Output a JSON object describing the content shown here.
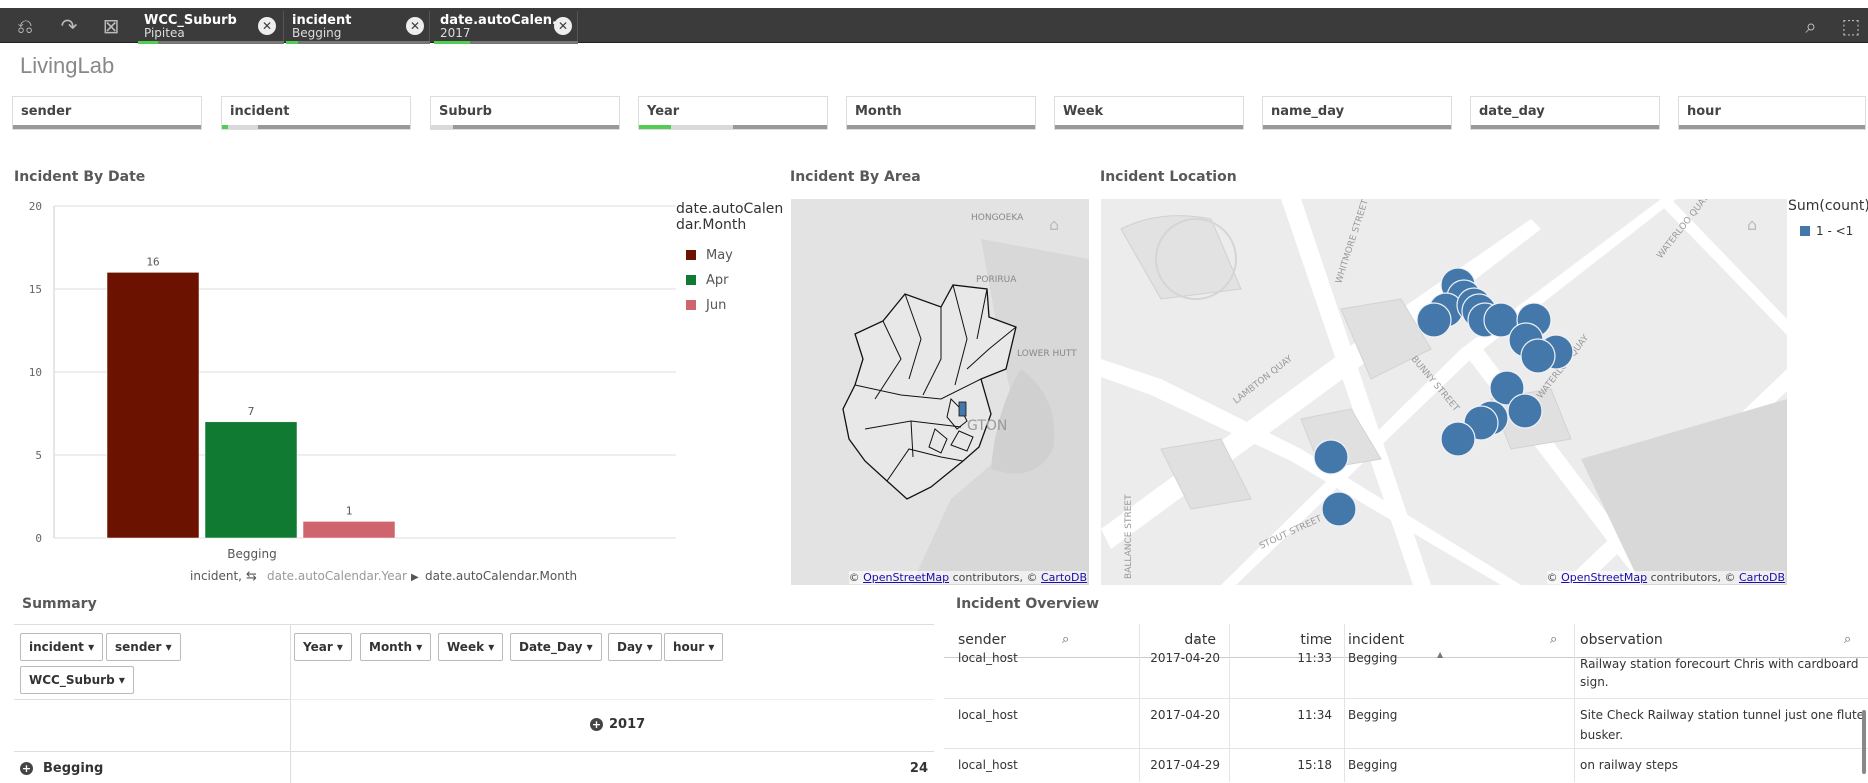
{
  "toolbar": {
    "icons": [
      "undo-icon",
      "redo-icon",
      "clear-selections-icon",
      "search-icon",
      "selection-tool-icon"
    ],
    "chips": [
      {
        "field": "WCC_Suburb",
        "value": "Pipitea"
      },
      {
        "field": "incident",
        "value": "Begging"
      },
      {
        "field": "date.autoCalen...",
        "value": "2017"
      }
    ]
  },
  "app": {
    "title": "LivingLab"
  },
  "filters": [
    {
      "label": "sender"
    },
    {
      "label": "incident"
    },
    {
      "label": "Suburb"
    },
    {
      "label": "Year"
    },
    {
      "label": "Month"
    },
    {
      "label": "Week"
    },
    {
      "label": "name_day"
    },
    {
      "label": "date_day"
    },
    {
      "label": "hour"
    }
  ],
  "sections": {
    "incident_by_date": "Incident By Date",
    "incident_by_area": "Incident By Area",
    "incident_location": "Incident Location",
    "summary": "Summary",
    "incident_overview": "Incident Overview"
  },
  "chart_data": {
    "type": "bar",
    "categories": [
      "Begging"
    ],
    "series": [
      {
        "name": "May",
        "values": [
          16
        ],
        "color": "#6b1200"
      },
      {
        "name": "Apr",
        "values": [
          7
        ],
        "color": "#107a32"
      },
      {
        "name": "Jun",
        "values": [
          1
        ],
        "color": "#d0646e"
      }
    ],
    "yticks": [
      0,
      5,
      10,
      15,
      20
    ],
    "ylim": [
      0,
      20
    ],
    "legend_title": "date.autoCalen-dar.Month",
    "legend_position": "right",
    "grid": true,
    "xlabel_prefix": "incident,",
    "xlabel_dim1": "date.autoCalendar.Year",
    "xlabel_dim2": "date.autoCalendar.Month"
  },
  "area_map": {
    "labels": [
      "HONGOEKA",
      "PORIRUA",
      "LOWER HUTT",
      "GTON"
    ],
    "attribution_prefix": "©",
    "attribution_link1": "OpenStreetMap",
    "attribution_middle": "contributors, ©",
    "attribution_link2": "CartoDB"
  },
  "location_map": {
    "street_labels": [
      "LAMBTON QUAY",
      "BUNNY STREET",
      "WATERLOO QUAY",
      "STOUT STREET",
      "WHITMORE STREET",
      "BALLANCE STREET",
      "WATERLOO QUAY"
    ],
    "legend_title": "Sum(count)",
    "legend_item": "1 - <1",
    "point_color": "#4477aa"
  },
  "summary": {
    "row_dims": [
      "incident",
      "sender",
      "WCC_Suburb"
    ],
    "col_dims": [
      "Year",
      "Month",
      "Week",
      "Date_Day",
      "Day",
      "hour"
    ],
    "year": "2017",
    "row_label": "Begging",
    "row_value": "24"
  },
  "overview": {
    "columns": [
      "sender",
      "date",
      "time",
      "incident",
      "observation"
    ],
    "rows": [
      {
        "sender": "local_host",
        "date": "2017-04-20",
        "time": "11:33",
        "incident": "Begging",
        "obs1": "Railway station forecourt Chris with cardboard",
        "obs2": "sign."
      },
      {
        "sender": "local_host",
        "date": "2017-04-20",
        "time": "11:34",
        "incident": "Begging",
        "obs1": "Site Check Railway station tunnel just one flute",
        "obs2": "busker."
      },
      {
        "sender": "local_host",
        "date": "2017-04-29",
        "time": "15:18",
        "incident": "Begging",
        "obs1": "on railway steps",
        "obs2": ""
      }
    ]
  }
}
